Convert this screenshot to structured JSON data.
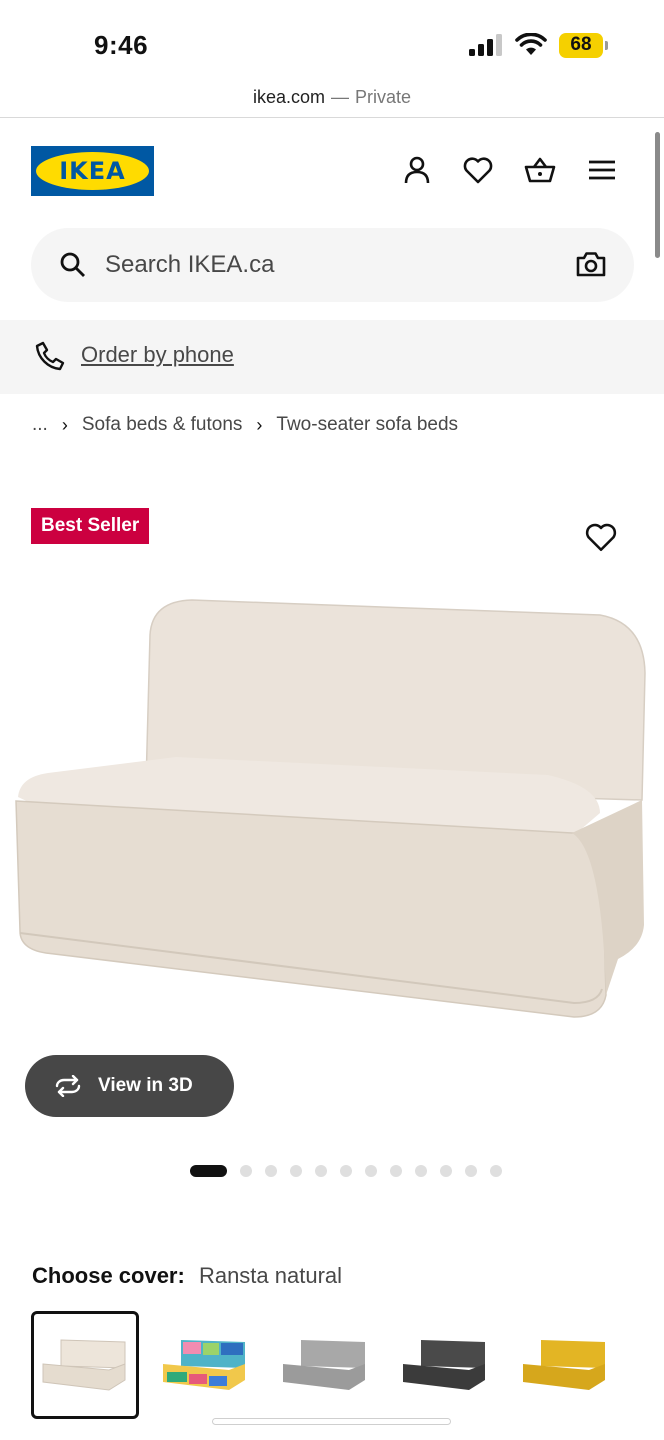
{
  "status_bar": {
    "time": "9:46",
    "battery": "68"
  },
  "url_bar": {
    "domain": "ikea.com",
    "separator": "—",
    "mode": "Private"
  },
  "header": {
    "logo_text": "IKEA",
    "colors": {
      "brand_blue": "#0058a3",
      "brand_yellow": "#ffdb00"
    },
    "icons": [
      "account-icon",
      "heart-icon",
      "basket-icon",
      "menu-icon"
    ]
  },
  "search": {
    "placeholder": "Search IKEA.ca"
  },
  "order_phone": {
    "label": "Order by phone"
  },
  "breadcrumb": [
    "...",
    "Sofa beds & futons",
    "Two-seater sofa beds"
  ],
  "product": {
    "badge": "Best Seller",
    "badge_color": "#cc0040",
    "view_3d_label": "View in 3D",
    "gallery": {
      "total_images": 12,
      "active_index": 0
    },
    "cover": {
      "label": "Choose cover:",
      "value": "Ransta natural",
      "options": [
        {
          "name": "Ransta natural",
          "color": "#ece4d8",
          "selected": true
        },
        {
          "name": "multicolour",
          "color": "#4fb3c8",
          "selected": false
        },
        {
          "name": "grey",
          "color": "#a3a3a3",
          "selected": false
        },
        {
          "name": "dark grey",
          "color": "#474747",
          "selected": false
        },
        {
          "name": "yellow",
          "color": "#e0b21f",
          "selected": false
        }
      ]
    }
  }
}
